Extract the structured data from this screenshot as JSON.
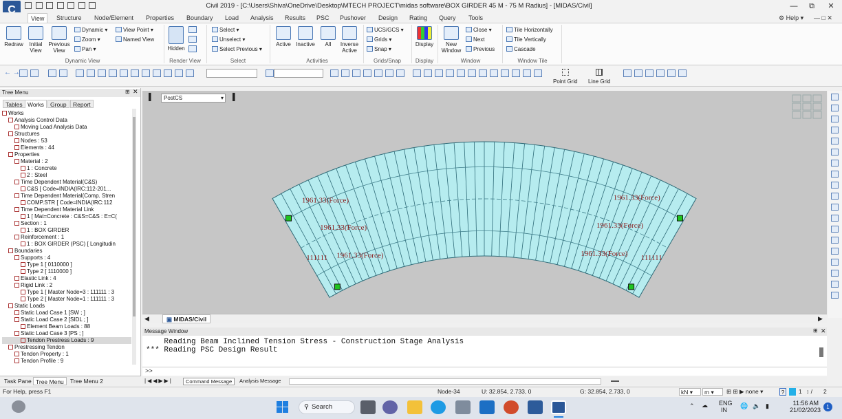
{
  "title_bar": {
    "title": "Civil 2019 - [C:\\Users\\Shiva\\OneDrive\\Desktop\\MTECH PROJECT\\midas software\\BOX GIRDER 45 M - 75 M Radius] - [MIDAS/Civil]",
    "help_label": "Help"
  },
  "menu": [
    "View",
    "Structure",
    "Node/Element",
    "Properties",
    "Boundary",
    "Load",
    "Analysis",
    "Results",
    "PSC",
    "Pushover",
    "Design",
    "Rating",
    "Query",
    "Tools"
  ],
  "ribbon": {
    "dynamic_view": {
      "label": "Dynamic View",
      "redraw": "Redraw",
      "initial_view": "Initial View",
      "previous_view": "Previous View",
      "dynamic": "Dynamic",
      "zoom": "Zoom",
      "pan": "Pan",
      "view_point": "View Point",
      "named_view": "Named View"
    },
    "render_view": {
      "label": "Render View",
      "hidden": "Hidden"
    },
    "select": {
      "label": "Select",
      "select": "Select",
      "unselect": "Unselect",
      "select_previous": "Select Previous"
    },
    "activities": {
      "label": "Activities",
      "active": "Active",
      "inactive": "Inactive",
      "all": "All",
      "inverse_active": "Inverse Active"
    },
    "grids_snap": {
      "label": "Grids/Snap",
      "ucs": "UCS/GCS",
      "grids": "Grids",
      "snap": "Snap"
    },
    "display": {
      "label": "Display",
      "display": "Display"
    },
    "window": {
      "label": "Window",
      "new_window": "New Window",
      "close": "Close",
      "next": "Next",
      "previous": "Previous"
    },
    "window_tile": {
      "label": "Window Tile",
      "tile_h": "Tile Horizontally",
      "tile_v": "Tile Vertically",
      "cascade": "Cascade"
    }
  },
  "toolbar": {
    "point_grid": "Point Grid",
    "line_grid": "Line Grid"
  },
  "tree": {
    "header": "Tree Menu",
    "tabs": [
      "Tables",
      "Works",
      "Group",
      "Report"
    ],
    "active_tab": "Works",
    "items": [
      {
        "text": "Works",
        "indent": 0
      },
      {
        "text": "Analysis Control Data",
        "indent": 1
      },
      {
        "text": "Moving Load Analysis Data",
        "indent": 2
      },
      {
        "text": "Structures",
        "indent": 1
      },
      {
        "text": "Nodes : 53",
        "indent": 2
      },
      {
        "text": "Elements : 44",
        "indent": 2
      },
      {
        "text": "Properties",
        "indent": 1
      },
      {
        "text": "Material : 2",
        "indent": 2
      },
      {
        "text": "1 : Concrete",
        "indent": 3
      },
      {
        "text": "2 : Steel",
        "indent": 3
      },
      {
        "text": "Time Dependent Material(C&S)",
        "indent": 2
      },
      {
        "text": "C&S [ Code=INDIA(IRC:112-201...",
        "indent": 3
      },
      {
        "text": "Time Dependent Material(Comp. Stren",
        "indent": 2
      },
      {
        "text": "COMP.STR [ Code=INDIA(IRC:112",
        "indent": 3
      },
      {
        "text": "Time Dependent Material Link",
        "indent": 2
      },
      {
        "text": "1 [ Mat=Concrete : C&S=C&S : E=C(",
        "indent": 3
      },
      {
        "text": "Section : 1",
        "indent": 2
      },
      {
        "text": "1 : BOX GIRDER",
        "indent": 3
      },
      {
        "text": "Reinforcement : 1",
        "indent": 2
      },
      {
        "text": "1 : BOX GIRDER (PSC) [ Longitudin",
        "indent": 3
      },
      {
        "text": "Boundaries",
        "indent": 1
      },
      {
        "text": "Supports : 4",
        "indent": 2
      },
      {
        "text": "Type 1 [ 0110000 ]",
        "indent": 3
      },
      {
        "text": "Type 2 [ 1110000 ]",
        "indent": 3
      },
      {
        "text": "Elastic Link : 4",
        "indent": 2
      },
      {
        "text": "Rigid Link : 2",
        "indent": 2
      },
      {
        "text": "Type 1 [ Master Node=3 : 111111 : 3",
        "indent": 3
      },
      {
        "text": "Type 2 [ Master Node=1 : 111111 : 3",
        "indent": 3
      },
      {
        "text": "Static Loads",
        "indent": 1
      },
      {
        "text": "Static Load Case 1 [SW ; ]",
        "indent": 2
      },
      {
        "text": "Static Load Case 2 [SIDL ; ]",
        "indent": 2
      },
      {
        "text": "Element Beam Loads : 88",
        "indent": 3
      },
      {
        "text": "Static Load Case 3 [PS ; ]",
        "indent": 2
      },
      {
        "text": "Tendon Prestress Loads : 9",
        "indent": 3
      },
      {
        "text": "Prestressing Tendon",
        "indent": 1
      },
      {
        "text": "Tendon Property : 1",
        "indent": 2
      },
      {
        "text": "Tendon Profile : 9",
        "indent": 2
      }
    ],
    "selected_index": 33,
    "bottom_tabs": [
      "Task Pane",
      "Tree Menu",
      "Tree Menu 2"
    ]
  },
  "view": {
    "stage_combo": "PostCS",
    "tab_label": "MIDAS/Civil",
    "labels": [
      {
        "text": "1961.33(Force)"
      },
      {
        "text": "1961.33(Force)"
      },
      {
        "text": "1961.33(Force)"
      },
      {
        "text": "1961.33(Force)"
      },
      {
        "text": "1961.33(Force)"
      },
      {
        "text": "1961.33(Force)"
      },
      {
        "text": "111111"
      },
      {
        "text": "111111"
      }
    ]
  },
  "message": {
    "header": "Message Window",
    "lines": [
      "    Reading Beam Inclined Tension Stress - Construction Stage Analysis",
      "*** Reading PSC Design Result"
    ],
    "prompt": ">>",
    "tabs": [
      "Command Message",
      "Analysis Message"
    ]
  },
  "status": {
    "help": "For Help, press F1",
    "node": "Node-34",
    "ucs": "U: 32.854, 2.733, 0",
    "gcs": "G: 32.854, 2.733, 0",
    "force_unit": "kN",
    "length_unit": "m",
    "page": "1",
    "pages": "2"
  },
  "taskbar": {
    "search": "Search",
    "lang1": "ENG",
    "lang2": "IN",
    "time": "11:56 AM",
    "date": "21/02/2023",
    "badge": "1"
  },
  "colors": {
    "deck": "#b6ecef",
    "deck_edge": "#2f6b78",
    "force_text": "#8b1a1a",
    "support": "#1fc41f"
  }
}
